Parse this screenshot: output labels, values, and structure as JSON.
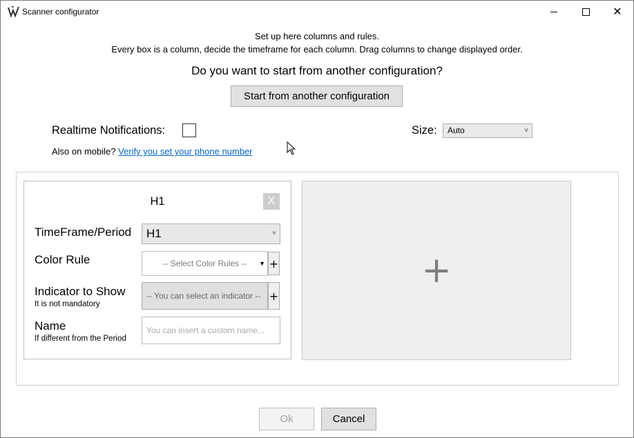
{
  "window": {
    "title": "Scanner configurator",
    "app_icon": "scanner-logo-icon",
    "controls": [
      "minimize-icon",
      "maximize-icon",
      "close-icon"
    ],
    "close_glyph": "✕"
  },
  "intro": {
    "line1": "Set up here columns and rules.",
    "line2": "Every box is a column, decide the timeframe for each column. Drag columns to change displayed order."
  },
  "start_config": {
    "question": "Do you want to start from another configuration?",
    "button_label": "Start from another configuration"
  },
  "notifications": {
    "label": "Realtime Notifications:",
    "checked": false
  },
  "size": {
    "label": "Size:",
    "selected": "Auto"
  },
  "mobile": {
    "prefix": "Also on mobile?",
    "link": "Verify you set your phone number"
  },
  "column": {
    "title": "H1",
    "remove_label": "X",
    "timeframe": {
      "label": "TimeFrame/Period",
      "selected": "H1"
    },
    "color_rule": {
      "label": "Color Rule",
      "placeholder": "-- Select Color Rules --",
      "add_label": "+"
    },
    "indicator": {
      "label": "Indicator to Show",
      "sublabel": "It is not mandatory",
      "placeholder": "-- You can select an indicator --",
      "add_label": "+"
    },
    "name": {
      "label": "Name",
      "sublabel": "If different from the Period",
      "placeholder": "You can insert a custom name..."
    }
  },
  "add_column": {
    "glyph": "+"
  },
  "footer": {
    "ok_label": "Ok",
    "ok_enabled": false,
    "cancel_label": "Cancel"
  },
  "colors": {
    "link": "#0066cc",
    "button_bg": "#e1e1e1",
    "disabled_text": "#a0a0a0",
    "add_panel_bg": "#efefef"
  }
}
